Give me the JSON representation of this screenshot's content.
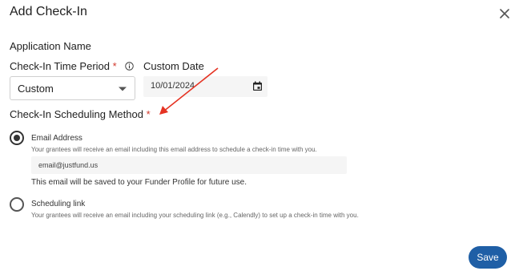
{
  "dialog": {
    "title": "Add Check-In",
    "close_icon": "close-icon"
  },
  "form": {
    "application_name_label": "Application Name",
    "period": {
      "label": "Check-In Time Period",
      "required_mark": "*",
      "info_icon": "info-icon",
      "selected": "Custom"
    },
    "custom_date": {
      "label": "Custom Date",
      "value": "10/01/2024",
      "calendar_icon": "calendar-icon"
    },
    "method": {
      "label": "Check-In Scheduling Method",
      "required_mark": "*",
      "email": {
        "label": "Email Address",
        "selected": true,
        "description": "Your grantees will receive an email including this email address to schedule a check-in time with you.",
        "value": "email@justfund.us",
        "note": "This email will be saved to your Funder Profile for future use."
      },
      "link": {
        "label": "Scheduling link",
        "selected": false,
        "description": "Your grantees will receive an email including your scheduling link (e.g., Calendly) to set up a check-in time with you."
      }
    }
  },
  "actions": {
    "save_label": "Save"
  },
  "colors": {
    "required": "#d1372b",
    "primary": "#1f5fa6",
    "annotation_arrow": "#e53323"
  }
}
